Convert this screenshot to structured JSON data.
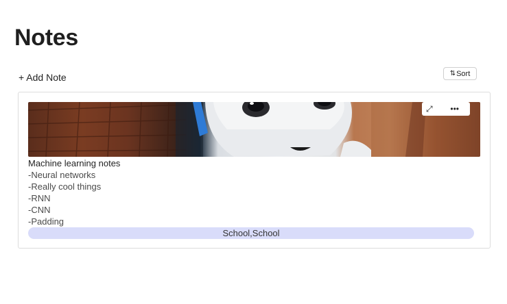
{
  "page": {
    "title": "Notes"
  },
  "toolbar": {
    "add_note_label": "+ Add Note",
    "sort_label": "Sort",
    "sort_icon": "sort-arrows-icon"
  },
  "note": {
    "cover_image": "robot-photo",
    "expand_icon": "expand-icon",
    "more_icon": "more-options-icon",
    "title": "Machine learning notes",
    "lines": [
      "-Neural networks",
      "-Really cool things",
      "-RNN",
      "-CNN",
      "-Padding"
    ],
    "tags": "School,School"
  },
  "colors": {
    "tag_background": "#d9dcfa",
    "card_border": "#dcdcdc"
  }
}
